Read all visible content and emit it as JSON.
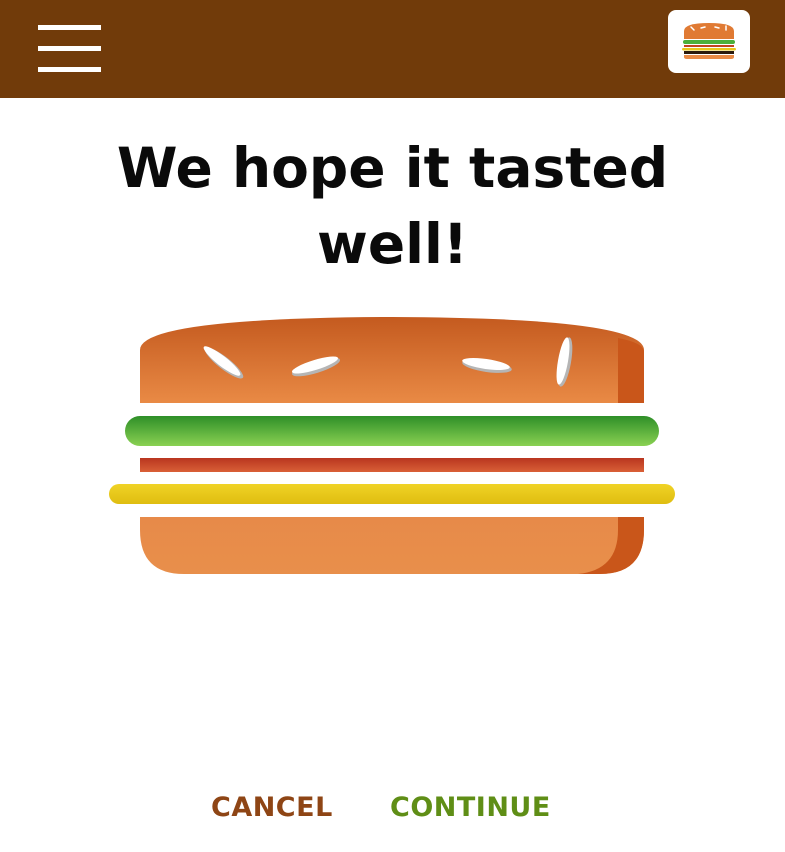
{
  "header": {
    "menu_icon": "hamburger-menu-icon",
    "logo_icon": "burger-logo-icon",
    "background_color": "#713b0a"
  },
  "main": {
    "title_line1": "We hope it tasted",
    "title_line2": "well!",
    "illustration_icon": "burger-illustration"
  },
  "actions": {
    "cancel_label": "CANCEL",
    "continue_label": "CONTINUE",
    "cancel_color": "#8e4515",
    "continue_color": "#5f8e16"
  }
}
